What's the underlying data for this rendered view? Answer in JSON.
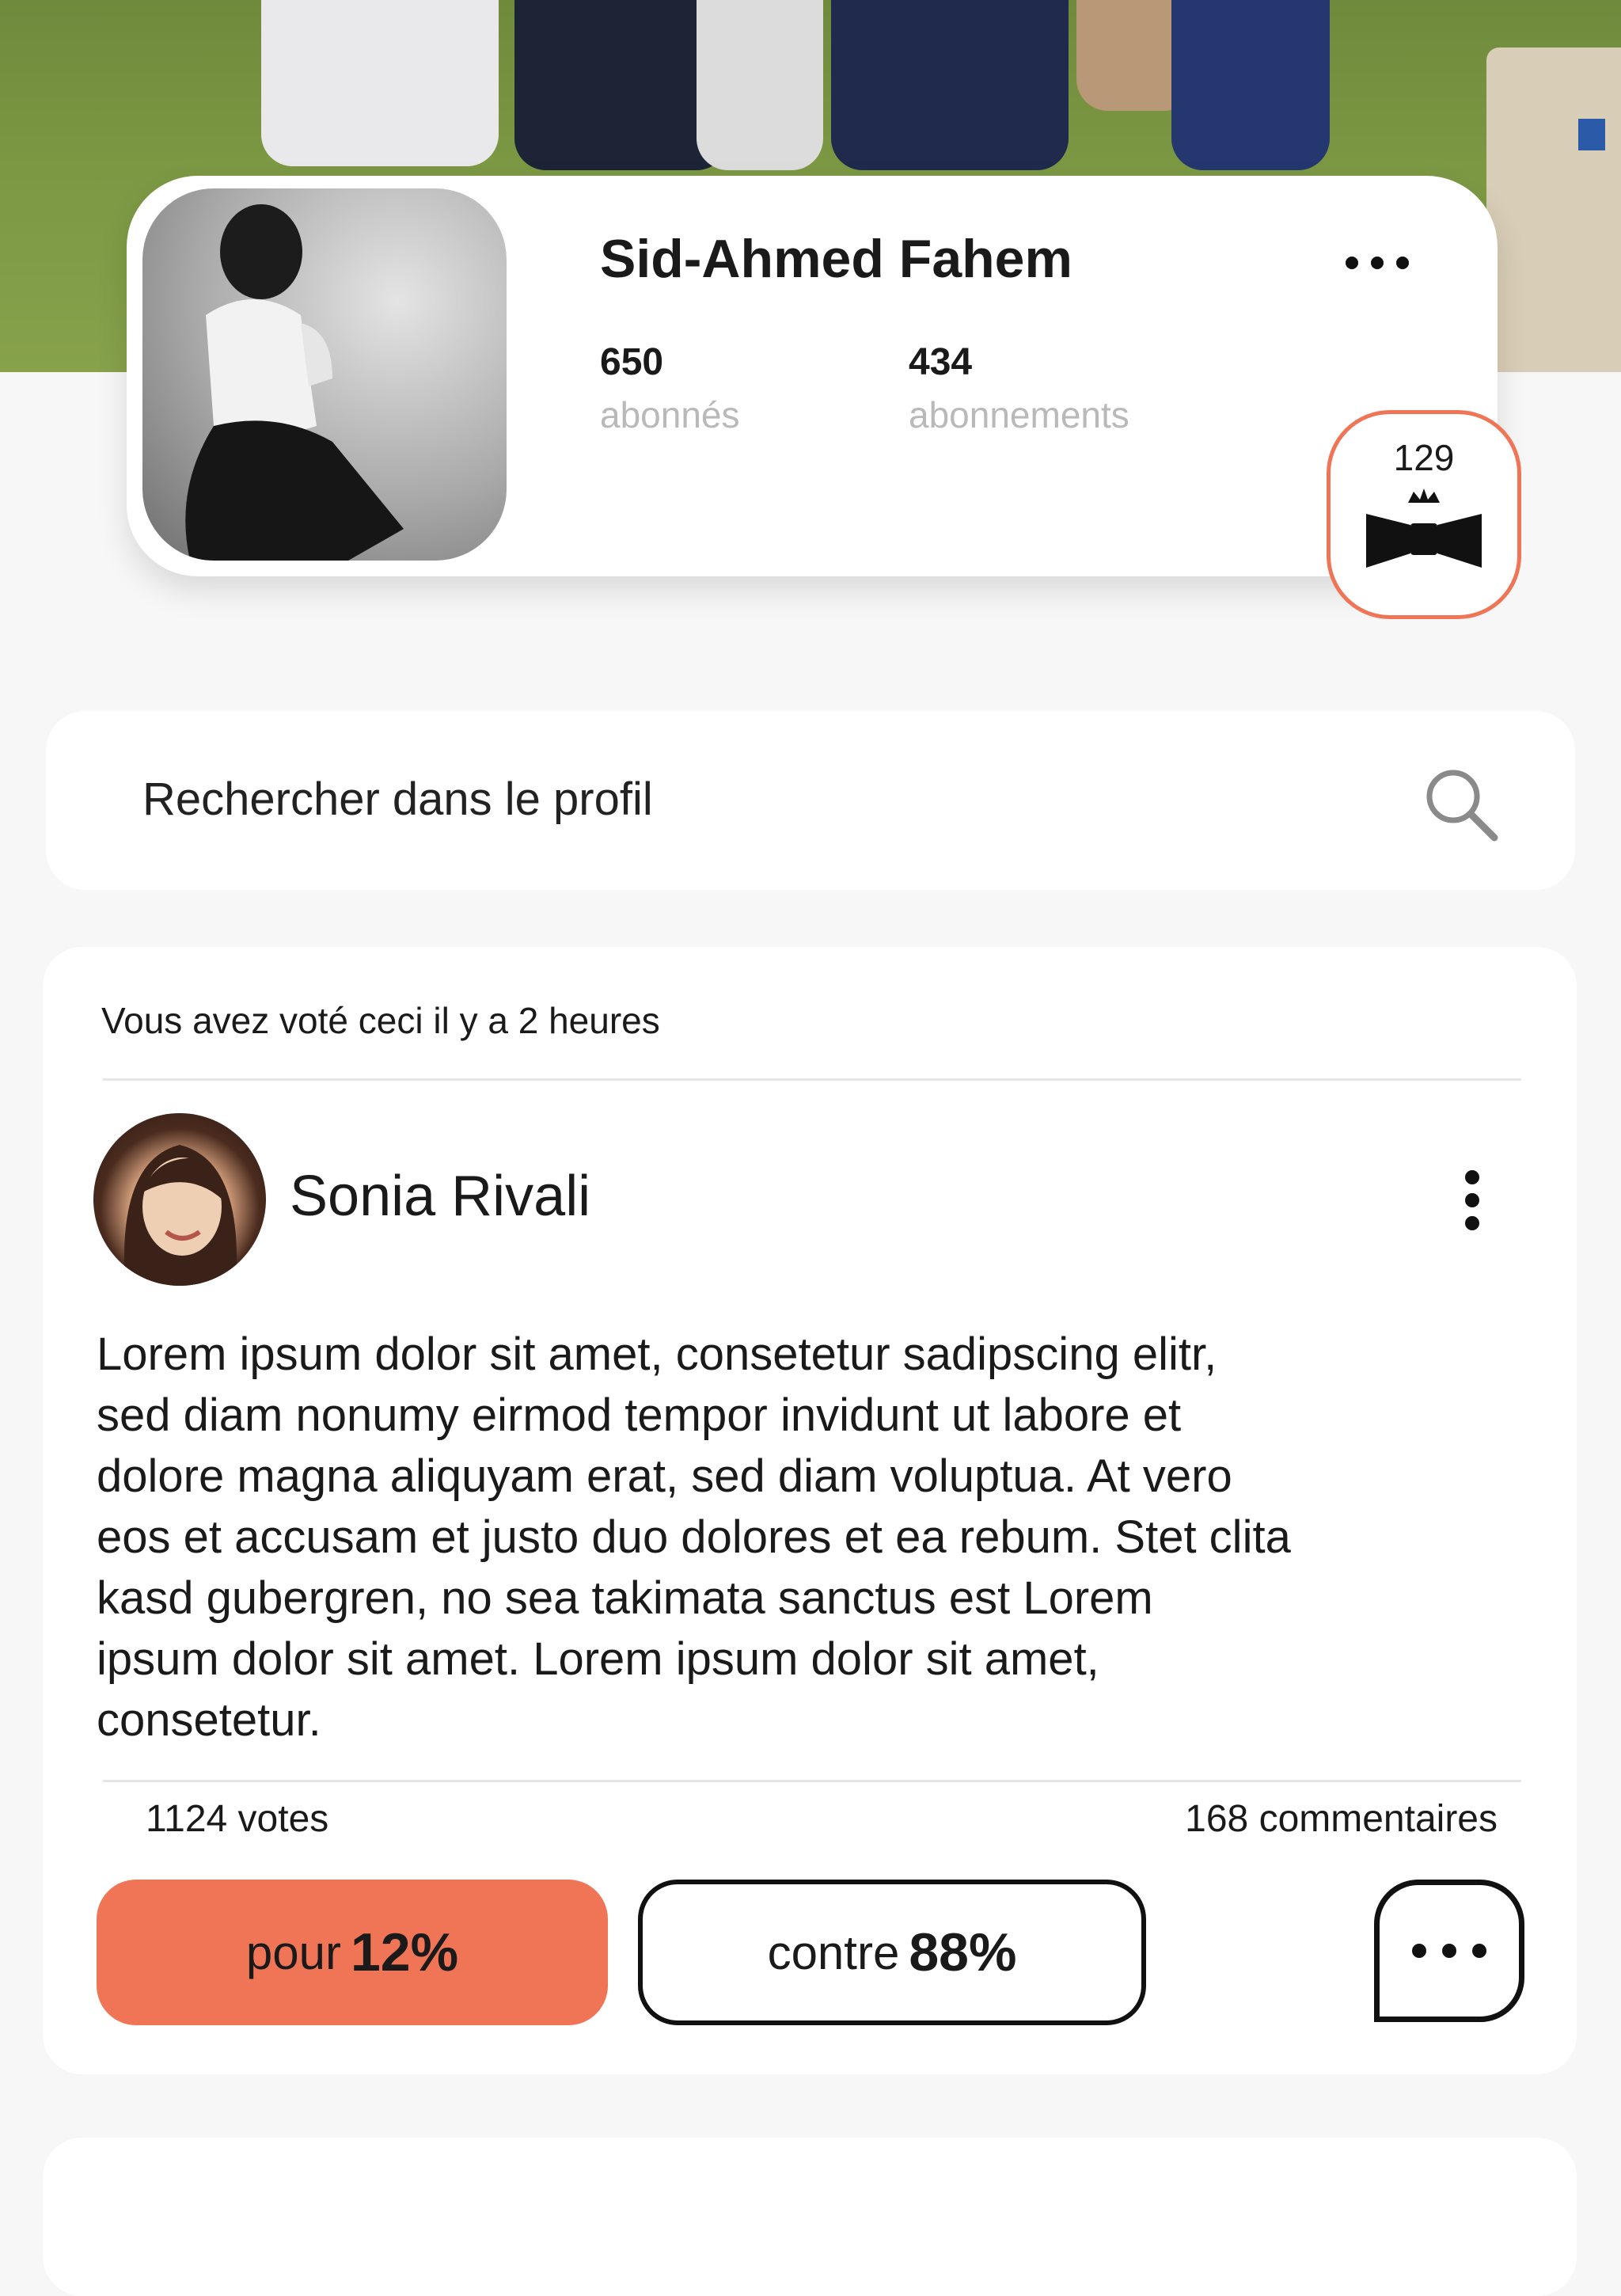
{
  "profile": {
    "name": "Sid-Ahmed Fahem",
    "followers_count": "650",
    "followers_label": "abonnés",
    "following_count": "434",
    "following_label": "abonnements",
    "badge_count": "129",
    "options_icon": "more-horizontal-icon",
    "badge_icon": "crown-bowtie-icon"
  },
  "search": {
    "placeholder": "Rechercher dans le profil",
    "icon": "search-icon"
  },
  "post": {
    "voted_notice": "Vous avez voté ceci il y a 2 heures",
    "author": "Sonia Rivali",
    "options_icon": "more-vertical-icon",
    "text": "Lorem ipsum dolor sit amet, consetetur sadipscing elitr,\nsed diam nonumy eirmod tempor invidunt ut labore et\ndolore magna aliquyam erat, sed diam voluptua. At vero\neos et accusam et justo duo dolores et ea rebum. Stet clita\nkasd gubergren, no sea takimata sanctus est Lorem\nipsum dolor sit amet. Lorem ipsum dolor sit amet,\nconsetetur.",
    "votes": "1124 votes",
    "comments": "168 commentaires",
    "pour_label": "pour",
    "pour_percent": "12%",
    "contre_label": "contre",
    "contre_percent": "88%",
    "comment_icon": "comment-bubble-icon"
  },
  "colors": {
    "accent": "#f07556",
    "background": "#f7f7f7",
    "card": "#ffffff"
  }
}
